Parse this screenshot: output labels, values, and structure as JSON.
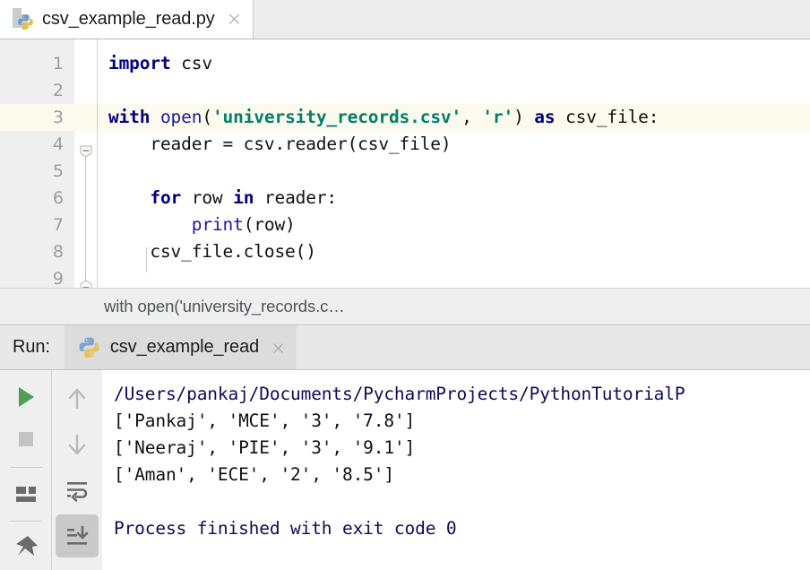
{
  "editor": {
    "tab": {
      "title": "csv_example_read.py",
      "icon": "python-file-icon",
      "close": "×"
    },
    "lines": [
      {
        "num": "1",
        "highlight": false,
        "tokens": [
          {
            "t": "kw",
            "s": "import"
          },
          {
            "t": "pln",
            "s": " csv"
          }
        ]
      },
      {
        "num": "2",
        "highlight": false,
        "tokens": []
      },
      {
        "num": "3",
        "highlight": true,
        "tokens": [
          {
            "t": "kw",
            "s": "with"
          },
          {
            "t": "pln",
            "s": " "
          },
          {
            "t": "fn",
            "s": "open"
          },
          {
            "t": "pln",
            "s": "("
          },
          {
            "t": "str",
            "s": "'university_records.csv'"
          },
          {
            "t": "pln",
            "s": ", "
          },
          {
            "t": "str",
            "s": "'r'"
          },
          {
            "t": "pln",
            "s": ") "
          },
          {
            "t": "kw",
            "s": "as"
          },
          {
            "t": "pln",
            "s": " csv_file:"
          }
        ]
      },
      {
        "num": "4",
        "highlight": false,
        "tokens": [
          {
            "t": "pln",
            "s": "    reader = csv.reader(csv_file)"
          }
        ]
      },
      {
        "num": "5",
        "highlight": false,
        "tokens": []
      },
      {
        "num": "6",
        "highlight": false,
        "tokens": [
          {
            "t": "pln",
            "s": "    "
          },
          {
            "t": "kw",
            "s": "for"
          },
          {
            "t": "pln",
            "s": " row "
          },
          {
            "t": "kw",
            "s": "in"
          },
          {
            "t": "pln",
            "s": " reader:"
          }
        ]
      },
      {
        "num": "7",
        "highlight": false,
        "tokens": [
          {
            "t": "pln",
            "s": "        "
          },
          {
            "t": "fn",
            "s": "print"
          },
          {
            "t": "pln",
            "s": "(row)"
          }
        ]
      },
      {
        "num": "8",
        "highlight": false,
        "tokens": [
          {
            "t": "pln",
            "s": "    csv_file.close()"
          }
        ]
      },
      {
        "num": "9",
        "highlight": false,
        "tokens": []
      }
    ]
  },
  "breadcrumb": {
    "text": "with open('university_records.c…"
  },
  "run_panel": {
    "label": "Run:",
    "tab_title": "csv_example_read",
    "tab_icon": "python-icon",
    "tab_close": "×",
    "toolbar_left": [
      {
        "name": "rerun-button",
        "icon": "play-icon"
      },
      {
        "name": "stop-button",
        "icon": "stop-icon"
      },
      {
        "name": "layout-button",
        "icon": "layout-icon"
      },
      {
        "name": "pin-button",
        "icon": "pin-icon"
      }
    ],
    "toolbar_right": [
      {
        "name": "up-button",
        "icon": "arrow-up-icon"
      },
      {
        "name": "down-button",
        "icon": "arrow-down-icon"
      },
      {
        "name": "soft-wrap-button",
        "icon": "soft-wrap-icon"
      },
      {
        "name": "scroll-to-end-button",
        "icon": "scroll-to-end-icon",
        "selected": true
      }
    ],
    "console_lines": [
      {
        "style": "path",
        "text": "/Users/pankaj/Documents/PycharmProjects/PythonTutorialP"
      },
      {
        "style": "out",
        "text": "['Pankaj', 'MCE', '3', '7.8']"
      },
      {
        "style": "out",
        "text": "['Neeraj', 'PIE', '3', '9.1']"
      },
      {
        "style": "out",
        "text": "['Aman', 'ECE', '2', '8.5']"
      },
      {
        "style": "blank",
        "text": " "
      },
      {
        "style": "path",
        "text": "Process finished with exit code 0"
      }
    ]
  },
  "colors": {
    "keyword": "#00007f",
    "string": "#00806c",
    "function": "#1a1a9c",
    "plain": "#111111",
    "console_blue": "#0c0c5a",
    "line_highlight": "#fcfaec",
    "gutter_bg": "#efefef",
    "play_green": "#4f9e55",
    "stop_gray": "#c3c3c3"
  }
}
